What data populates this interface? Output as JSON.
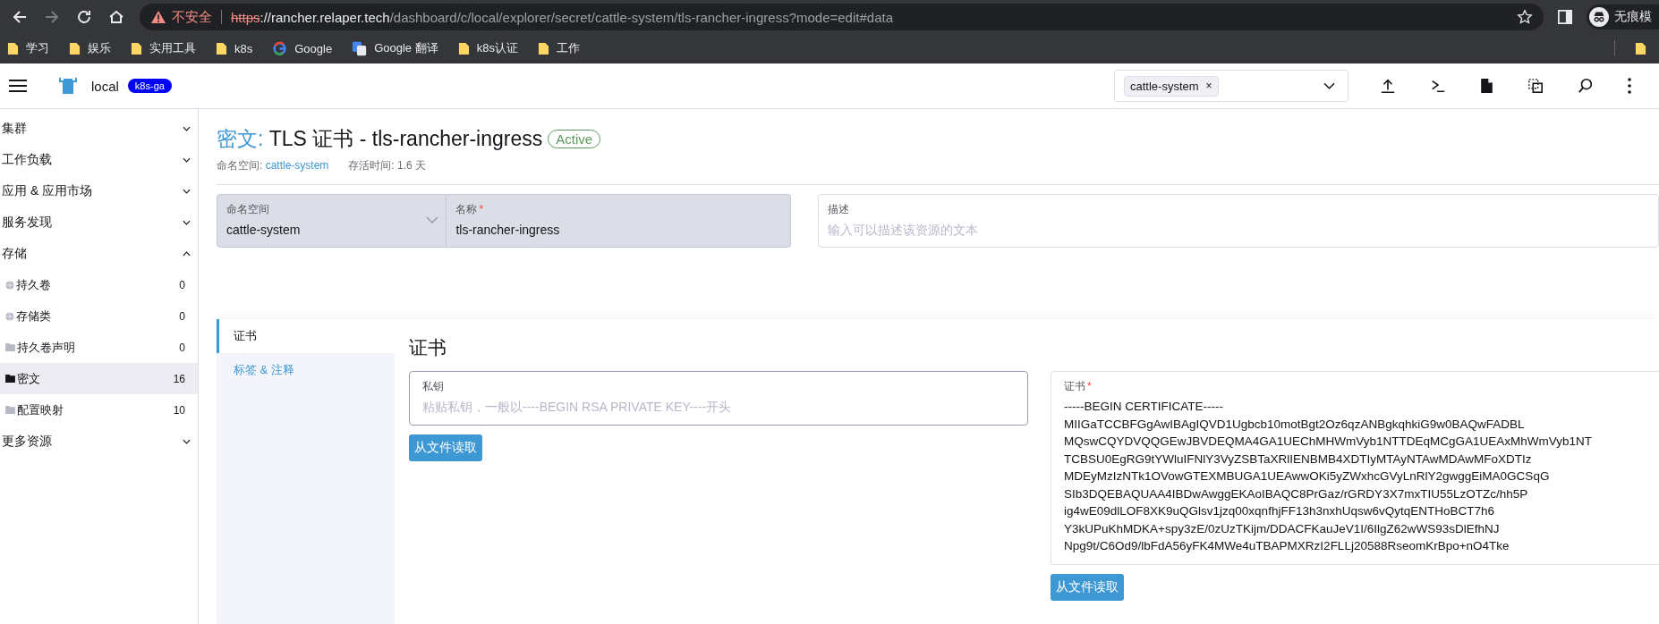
{
  "browser": {
    "nav": {
      "back_enabled": true,
      "forward_enabled": false
    },
    "insecure_label": "不安全",
    "url_scheme": "https",
    "url_host": "://rancher.relaper.tech",
    "url_path": "/dashboard/c/local/explorer/secret/cattle-system/tls-rancher-ingress?mode=edit#data",
    "profile_label": "无痕模"
  },
  "bookmarks": [
    {
      "label": "学习",
      "kind": "folder"
    },
    {
      "label": "娱乐",
      "kind": "folder"
    },
    {
      "label": "实用工具",
      "kind": "folder"
    },
    {
      "label": "k8s",
      "kind": "folder"
    },
    {
      "label": "Google",
      "kind": "google"
    },
    {
      "label": "Google 翻译",
      "kind": "translate"
    },
    {
      "label": "k8s认证",
      "kind": "folder"
    },
    {
      "label": "工作",
      "kind": "folder"
    }
  ],
  "header": {
    "cluster": "local",
    "badge": "k8s-ga",
    "namespace_chip": "cattle-system",
    "chip_remove": "×"
  },
  "sidebar": {
    "groups": [
      {
        "label": "集群",
        "expanded": false
      },
      {
        "label": "工作负载",
        "expanded": false
      },
      {
        "label": "应用 & 应用市场",
        "expanded": false
      },
      {
        "label": "服务发现",
        "expanded": false
      },
      {
        "label": "存储",
        "expanded": true,
        "children": [
          {
            "label": "持久卷",
            "count": "0",
            "kind": "globe",
            "selected": false
          },
          {
            "label": "存储类",
            "count": "0",
            "kind": "globe",
            "selected": false
          },
          {
            "label": "持久卷声明",
            "count": "0",
            "kind": "folder",
            "selected": false
          },
          {
            "label": "密文",
            "count": "16",
            "kind": "folder",
            "selected": true
          },
          {
            "label": "配置映射",
            "count": "10",
            "kind": "folder",
            "selected": false
          }
        ]
      },
      {
        "label": "更多资源",
        "expanded": false
      }
    ]
  },
  "page": {
    "type_label": "密文:",
    "title": "TLS 证书 - tls-rancher-ingress",
    "status": "Active",
    "namespace_label": "命名空间:",
    "namespace": "cattle-system",
    "age_label": "存活时间:",
    "age": "1.6 天"
  },
  "form": {
    "namespace": {
      "label": "命名空间",
      "value": "cattle-system"
    },
    "name": {
      "label": "名称",
      "required_mark": "*",
      "value": "tls-rancher-ingress"
    },
    "description": {
      "label": "描述",
      "placeholder": "输入可以描述该资源的文本"
    }
  },
  "tabs": [
    {
      "label": "证书",
      "selected": true
    },
    {
      "label": "标签 & 注释",
      "selected": false
    }
  ],
  "certificate_section": {
    "heading": "证书",
    "private_key": {
      "label": "私钥",
      "placeholder": "粘贴私钥，一般以----BEGIN RSA PRIVATE KEY----开头",
      "button": "从文件读取"
    },
    "certificate": {
      "label": "证书",
      "required_mark": "*",
      "button": "从文件读取",
      "value_lines": [
        "-----BEGIN CERTIFICATE-----",
        "MIIGaTCCBFGgAwIBAgIQVD1Ugbcb10motBgt2Oz6qzANBgkqhkiG9w0BAQwFADBL",
        "MQswCQYDVQQGEwJBVDEQMA4GA1UEChMHWmVyb1NTTDEqMCgGA1UEAxMhWmVyb1NT",
        "TCBSU0EgRG9tYWluIFNlY3VyZSBTaXRlIENBMB4XDTIyMTAyNTAwMDAwMFoXDTIz",
        "MDEyMzIzNTk1OVowGTEXMBUGA1UEAwwOKi5yZWxhcGVyLnRlY2gwggEiMA0GCSqG",
        "SIb3DQEBAQUAA4IBDwAwggEKAoIBAQC8PrGaz/rGRDY3X7mxTIU55LzOTZc/hh5P",
        "ig4wE09dlLOF8XK9uQGlsv1jzq00xqnfhjFF13h3nxhUqsw6vQytqENTHoBCT7h6",
        "Y3kUPuKhMDKA+spy3zE/0zUzTKijm/DDACFKauJeV1I/6IlgZ62wWS93sDlEfhNJ",
        "Npg9t/C6Od9/lbFdA56yFK4MWe4uTBAPMXRzI2FLLj20588RseomKrBpo+nO4Tke"
      ]
    }
  }
}
